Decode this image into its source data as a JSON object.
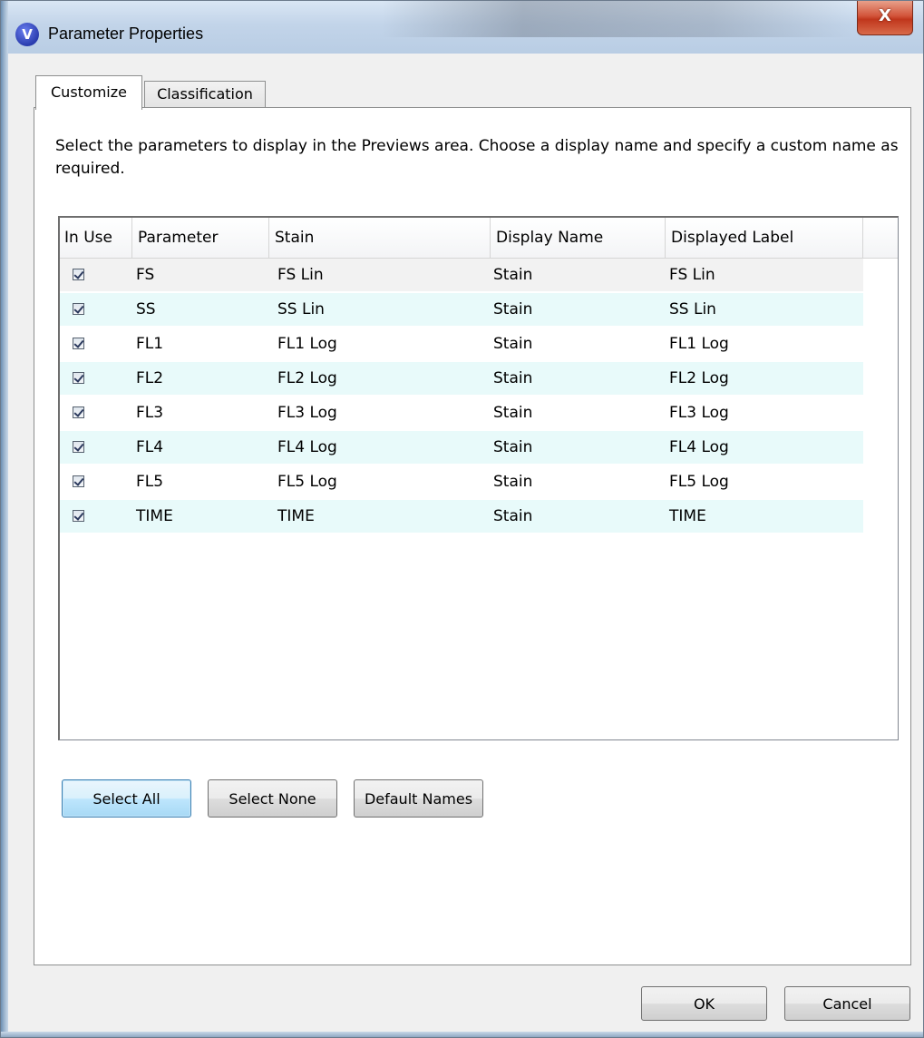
{
  "window": {
    "title": "Parameter Properties",
    "app_icon_glyph": "V",
    "close_glyph": "X"
  },
  "tabs": [
    {
      "label": "Customize",
      "active": true
    },
    {
      "label": "Classification",
      "active": false
    }
  ],
  "instructions": "Select the parameters to display in the Previews area. Choose a display name and specify a custom name as required.",
  "grid": {
    "headers": [
      "In Use",
      "Parameter",
      "Stain",
      "Display Name",
      "Displayed Label"
    ],
    "rows": [
      {
        "in_use": true,
        "parameter": "FS",
        "stain": "FS Lin",
        "display_name": "Stain",
        "displayed_label": "FS Lin"
      },
      {
        "in_use": true,
        "parameter": "SS",
        "stain": "SS Lin",
        "display_name": "Stain",
        "displayed_label": "SS Lin"
      },
      {
        "in_use": true,
        "parameter": "FL1",
        "stain": "FL1 Log",
        "display_name": "Stain",
        "displayed_label": "FL1 Log"
      },
      {
        "in_use": true,
        "parameter": "FL2",
        "stain": "FL2 Log",
        "display_name": "Stain",
        "displayed_label": "FL2 Log"
      },
      {
        "in_use": true,
        "parameter": "FL3",
        "stain": "FL3 Log",
        "display_name": "Stain",
        "displayed_label": "FL3 Log"
      },
      {
        "in_use": true,
        "parameter": "FL4",
        "stain": "FL4 Log",
        "display_name": "Stain",
        "displayed_label": "FL4 Log"
      },
      {
        "in_use": true,
        "parameter": "FL5",
        "stain": "FL5 Log",
        "display_name": "Stain",
        "displayed_label": "FL5 Log"
      },
      {
        "in_use": true,
        "parameter": "TIME",
        "stain": "TIME",
        "display_name": "Stain",
        "displayed_label": "TIME"
      }
    ]
  },
  "buttons": {
    "select_all": "Select All",
    "select_none": "Select None",
    "default_names": "Default Names",
    "ok": "OK",
    "cancel": "Cancel"
  },
  "colors": {
    "alt_row": "#e8fafa",
    "focus_border": "#3c7fb1",
    "close_button": "#c0361c"
  }
}
